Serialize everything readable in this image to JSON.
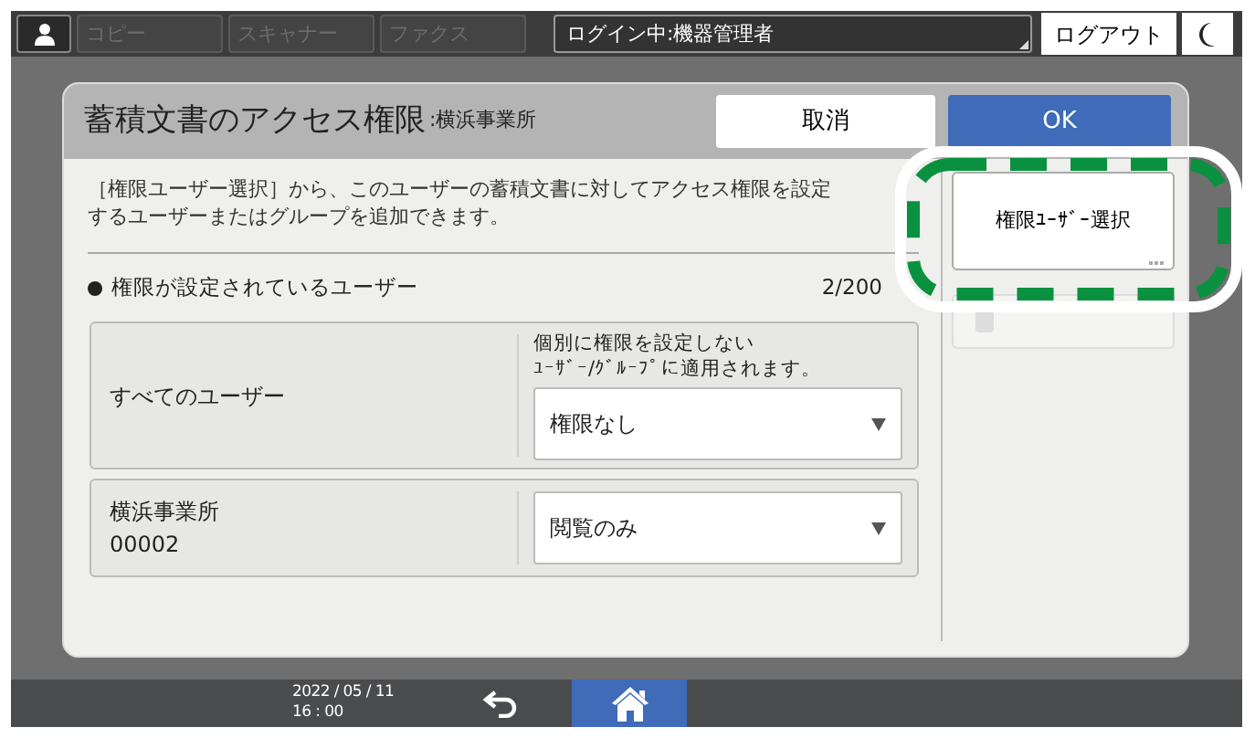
{
  "top_bar": {
    "apps": [
      {
        "label": "コピー",
        "disabled": true
      },
      {
        "label": "スキャナー",
        "disabled": true
      },
      {
        "label": "ファクス",
        "disabled": true
      }
    ],
    "login_status": "ログイン中:機器管理者",
    "logout": "ログアウト"
  },
  "dialog": {
    "title": "蓄積文書のアクセス権限",
    "subtitle": ":横浜事業所",
    "cancel": "取消",
    "ok": "OK",
    "description": "［権限ユーザー選択］から、このユーザーの蓄積文書に対してアクセス権限を設定するユーザーまたはグループを追加できます。",
    "section_label": "権限が設定されているユーザー",
    "count": "2/200",
    "rows": [
      {
        "kind": "all",
        "name": "すべてのユーザー",
        "note": [
          "個別に権限を設定しない",
          "ﾕｰｻﾞｰ/ｸﾞﾙｰﾌﾟに適用されます。"
        ],
        "permission": "権限なし"
      },
      {
        "kind": "user",
        "name": "横浜事業所",
        "id": "00002",
        "permission": "閲覧のみ"
      }
    ],
    "select_button": "権限ﾕｰｻﾞｰ選択"
  },
  "highlight": {
    "shown": true
  },
  "status_bar": {
    "date": "2022 / 05 / 11",
    "time": "16 : 00"
  }
}
